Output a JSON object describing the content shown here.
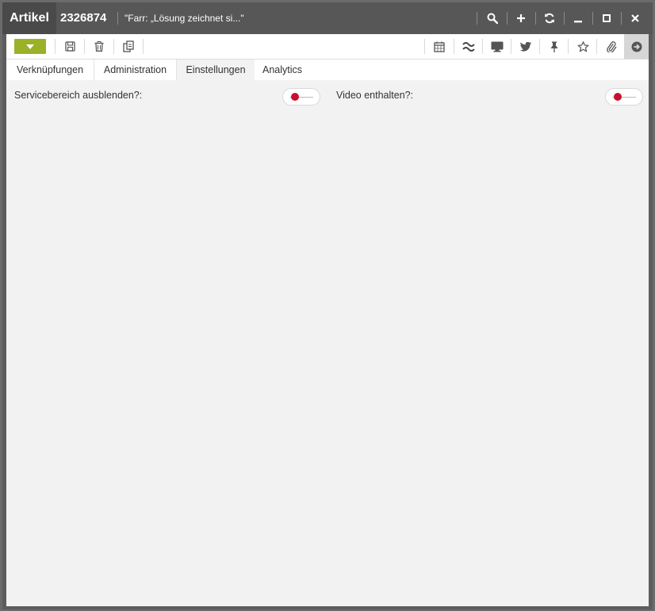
{
  "window": {
    "app_label": "Artikel",
    "record_id": "2326874",
    "document_title": "\"Farr: „Lösung zeichnet si...\""
  },
  "titlebar_buttons": [
    {
      "name": "search-icon"
    },
    {
      "name": "plus-icon"
    },
    {
      "name": "refresh-icon"
    },
    {
      "name": "minimize-icon"
    },
    {
      "name": "maximize-icon"
    },
    {
      "name": "close-icon"
    }
  ],
  "toolbar": {
    "left_tools": [
      "dropdown-caret-icon",
      "save-icon",
      "trash-icon",
      "copy-icon"
    ],
    "right_tools": [
      "calendar-icon",
      "wave-icon",
      "monitor-icon",
      "twitter-icon",
      "pin-icon",
      "star-icon",
      "paperclip-icon",
      "arrow-right-circle-icon"
    ],
    "accent_color": "#9bb128"
  },
  "tabs": [
    {
      "label": "Verknüpfungen",
      "active": false
    },
    {
      "label": "Administration",
      "active": false
    },
    {
      "label": "Einstellungen",
      "active": true
    },
    {
      "label": "Analytics",
      "active": false
    }
  ],
  "settings": {
    "service_label": "Servicebereich ausblenden?:",
    "service_enabled": false,
    "video_label": "Video enthalten?:",
    "video_enabled": false,
    "toggle_off_color": "#c8102e"
  }
}
